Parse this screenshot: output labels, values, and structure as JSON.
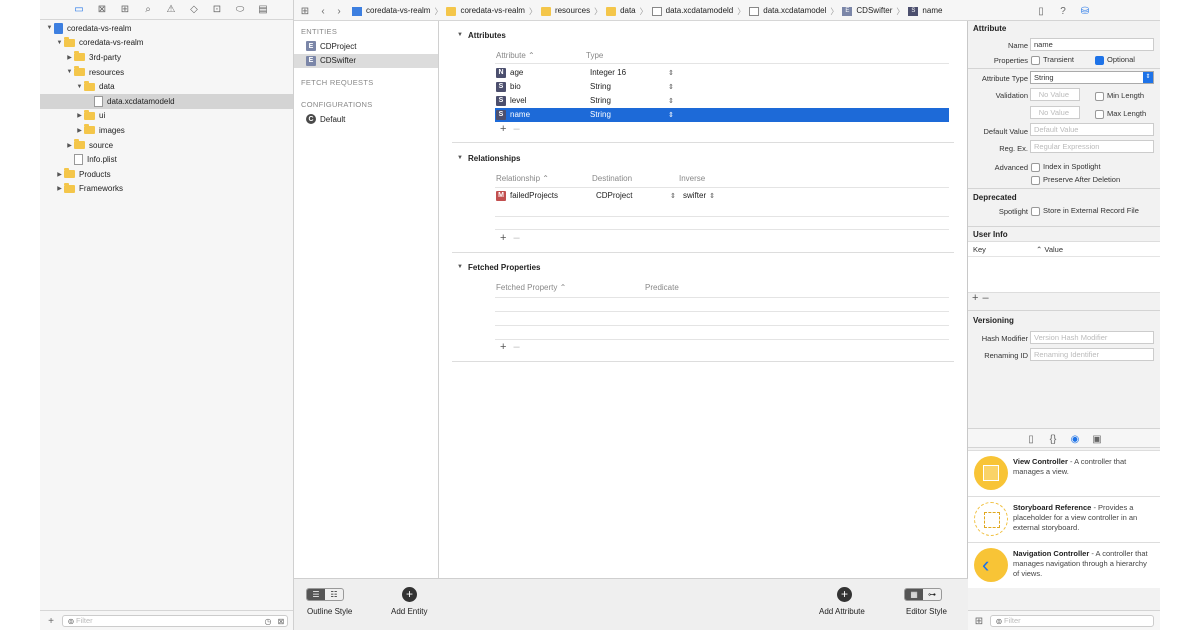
{
  "navigator": {
    "tree": [
      {
        "label": "coredata-vs-realm",
        "indent": 0,
        "kind": "project",
        "open": true
      },
      {
        "label": "coredata-vs-realm",
        "indent": 1,
        "kind": "folder",
        "open": true
      },
      {
        "label": "3rd-party",
        "indent": 2,
        "kind": "folder",
        "open": false
      },
      {
        "label": "resources",
        "indent": 2,
        "kind": "folder",
        "open": true
      },
      {
        "label": "data",
        "indent": 3,
        "kind": "folder",
        "open": true
      },
      {
        "label": "data.xcdatamodeld",
        "indent": 4,
        "kind": "model",
        "selected": true
      },
      {
        "label": "ui",
        "indent": 3,
        "kind": "folder",
        "open": false
      },
      {
        "label": "images",
        "indent": 3,
        "kind": "folder",
        "open": false
      },
      {
        "label": "source",
        "indent": 2,
        "kind": "folder",
        "open": false
      },
      {
        "label": "Info.plist",
        "indent": 2,
        "kind": "file"
      },
      {
        "label": "Products",
        "indent": 1,
        "kind": "folder",
        "open": false
      },
      {
        "label": "Frameworks",
        "indent": 1,
        "kind": "folder",
        "open": false
      }
    ],
    "filter_placeholder": "Filter"
  },
  "breadcrumb": [
    "coredata-vs-realm",
    "coredata-vs-realm",
    "resources",
    "data",
    "data.xcdatamodeld",
    "data.xcdatamodel",
    "CDSwifter",
    "name"
  ],
  "entities_panel": {
    "entities_header": "ENTITIES",
    "entities": [
      {
        "badge": "E",
        "label": "CDProject"
      },
      {
        "badge": "E",
        "label": "CDSwifter",
        "selected": true
      }
    ],
    "fetch_header": "FETCH REQUESTS",
    "config_header": "CONFIGURATIONS",
    "configs": [
      {
        "badge": "C",
        "label": "Default"
      }
    ]
  },
  "editor": {
    "attributes": {
      "title": "Attributes",
      "col_attr": "Attribute",
      "col_type": "Type",
      "rows": [
        {
          "badge": "N",
          "name": "age",
          "type": "Integer 16"
        },
        {
          "badge": "S",
          "name": "bio",
          "type": "String"
        },
        {
          "badge": "S",
          "name": "level",
          "type": "String"
        },
        {
          "badge": "S",
          "name": "name",
          "type": "String",
          "selected": true
        }
      ]
    },
    "relationships": {
      "title": "Relationships",
      "col_rel": "Relationship",
      "col_dest": "Destination",
      "col_inv": "Inverse",
      "rows": [
        {
          "badge": "M",
          "name": "failedProjects",
          "dest": "CDProject",
          "inverse": "swifter"
        }
      ]
    },
    "fetched": {
      "title": "Fetched Properties",
      "col_prop": "Fetched Property",
      "col_pred": "Predicate"
    }
  },
  "bottom_bar": {
    "outline_style": "Outline Style",
    "add_entity": "Add Entity",
    "add_attribute": "Add Attribute",
    "editor_style": "Editor Style"
  },
  "inspector": {
    "section_attribute": "Attribute",
    "name_label": "Name",
    "name_value": "name",
    "properties_label": "Properties",
    "transient": "Transient",
    "optional": "Optional",
    "attr_type_label": "Attribute Type",
    "attr_type_value": "String",
    "validation_label": "Validation",
    "no_value": "No Value",
    "min_length": "Min Length",
    "max_length": "Max Length",
    "default_value_label": "Default Value",
    "default_value_ph": "Default Value",
    "regex_label": "Reg. Ex.",
    "regex_ph": "Regular Expression",
    "advanced_label": "Advanced",
    "index_spotlight": "Index in Spotlight",
    "preserve": "Preserve After Deletion",
    "deprecated_title": "Deprecated",
    "spotlight_label": "Spotlight",
    "store_external": "Store in External Record File",
    "user_info_title": "User Info",
    "key_col": "Key",
    "value_col": "Value",
    "versioning_title": "Versioning",
    "hash_label": "Hash Modifier",
    "hash_ph": "Version Hash Modifier",
    "renaming_label": "Renaming ID",
    "renaming_ph": "Renaming Identifier",
    "filter_placeholder": "Filter"
  },
  "library": [
    {
      "title": "View Controller",
      "desc": " - A controller that manages a view."
    },
    {
      "title": "Storyboard Reference",
      "desc": " - Provides a placeholder for a view controller in an external storyboard."
    },
    {
      "title": "Navigation Controller",
      "desc": " - A controller that manages navigation through a hierarchy of views."
    }
  ],
  "colors": {
    "accent": "#1d6ad8",
    "selected_row": "#1d6ad8",
    "library_icon": "#f8c436"
  }
}
